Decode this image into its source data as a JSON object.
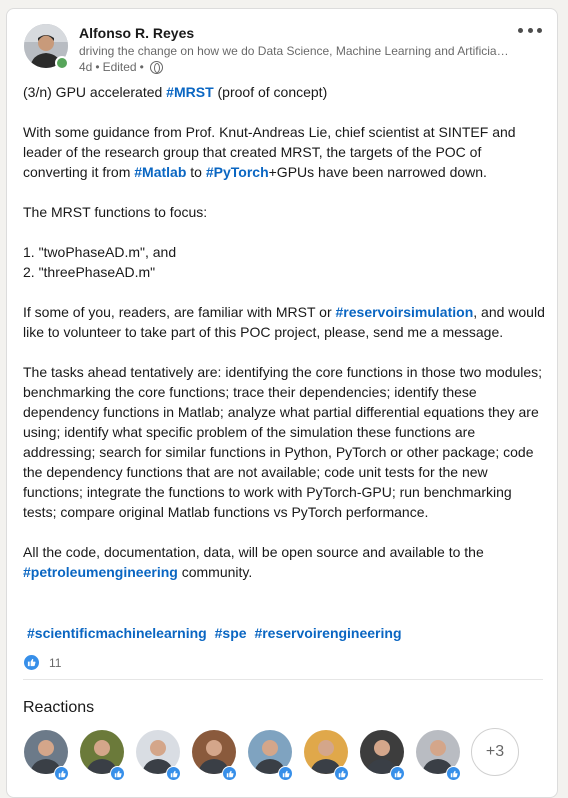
{
  "author": {
    "name": "Alfonso R. Reyes",
    "headline": "driving the change on how we do Data Science, Machine Learning and Artificial Intelligence",
    "age": "4d",
    "edited": "Edited",
    "separator": "•"
  },
  "post": {
    "p1": {
      "pre": "(3/n) GPU accelerated ",
      "tag": "#MRST",
      "post": " (proof of concept)"
    },
    "p2": {
      "pre": "With some guidance from Prof. Knut-Andreas Lie, chief scientist at SINTEF and leader of the research group that created MRST, the targets of the POC of converting it from ",
      "tag1": "#Matlab",
      "mid": " to ",
      "tag2": "#PyTorch",
      "post": "+GPUs have been narrowed down."
    },
    "p3": "The MRST functions to focus:",
    "list": [
      "1. \"twoPhaseAD.m\", and",
      "2. \"threePhaseAD.m\""
    ],
    "p4": {
      "pre": "If some of you, readers, are familiar with MRST or ",
      "tag": "#reservoirsimulation",
      "post": ", and would like to volunteer to take part of this POC project, please, send me a message."
    },
    "p5": "The tasks ahead tentatively are: identifying the core functions in those two modules; benchmarking the core functions; trace their dependencies; identify these dependency functions in Matlab; analyze what partial differential equations they are using; identify what specific problem of the simulation these functions are addressing; search for similar functions in Python, PyTorch or other package; code the dependency functions that are not available; code unit tests for the new functions; integrate the functions to work with PyTorch-GPU; run benchmarking tests; compare original Matlab functions vs PyTorch performance.",
    "p6": {
      "pre": "All the code, documentation, data, will be open source and available to the ",
      "tag": "#petroleumengineering",
      "post": " community."
    }
  },
  "hashtags": [
    "#scientificmachinelearning",
    "#spe",
    "#reservoirengineering"
  ],
  "reactions": {
    "count": "11",
    "title": "Reactions",
    "more_label": "+3",
    "like_color": "#378fe9",
    "reactor_colors": [
      "#6c7a89",
      "#6b7a3a",
      "#d9dde3",
      "#8a5a3c",
      "#7fa3c0",
      "#e0a84a",
      "#3d3d3d",
      "#b9bcc2"
    ]
  },
  "colors": {
    "link": "#0a66c2",
    "online": "#57a55a"
  }
}
